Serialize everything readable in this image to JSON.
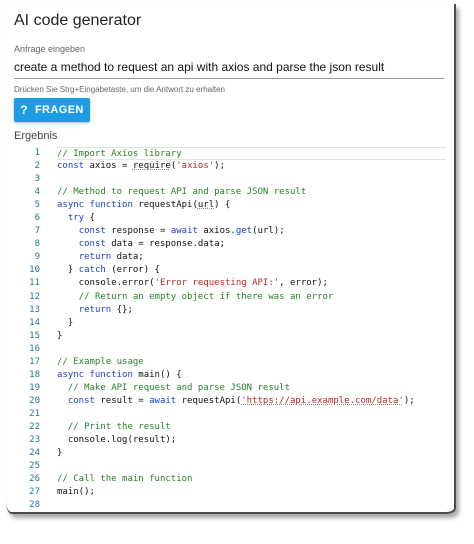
{
  "app": {
    "title": "AI code generator"
  },
  "input": {
    "label": "Anfrage eingeben",
    "value": "create a method to request an api with axios and parse the json result",
    "hint": "Drücken Sie Strg+Eingabetaste, um die Antwort zu erhalten"
  },
  "ask_button": {
    "icon": "question-mark-icon",
    "icon_glyph": "?",
    "label": "FRAGEN"
  },
  "result": {
    "label": "Ergebnis",
    "code_lines": [
      {
        "n": "1",
        "tokens": [
          {
            "t": "// Import Axios library",
            "c": "cm"
          }
        ]
      },
      {
        "n": "2",
        "tokens": [
          {
            "t": "const",
            "c": "kw"
          },
          {
            "t": " axios = ",
            "c": ""
          },
          {
            "t": "require",
            "c": "ul"
          },
          {
            "t": "(",
            "c": ""
          },
          {
            "t": "'axios'",
            "c": "st"
          },
          {
            "t": ");",
            "c": ""
          }
        ]
      },
      {
        "n": "3",
        "tokens": []
      },
      {
        "n": "4",
        "tokens": [
          {
            "t": "// Method to request API and parse JSON result",
            "c": "cm"
          }
        ]
      },
      {
        "n": "5",
        "tokens": [
          {
            "t": "async function",
            "c": "kw"
          },
          {
            "t": " requestApi(",
            "c": ""
          },
          {
            "t": "url",
            "c": "ul"
          },
          {
            "t": ") {",
            "c": ""
          }
        ]
      },
      {
        "n": "6",
        "tokens": [
          {
            "t": "  ",
            "c": ""
          },
          {
            "t": "try",
            "c": "kw"
          },
          {
            "t": " {",
            "c": ""
          }
        ]
      },
      {
        "n": "7",
        "tokens": [
          {
            "t": "    ",
            "c": ""
          },
          {
            "t": "const",
            "c": "kw"
          },
          {
            "t": " response = ",
            "c": ""
          },
          {
            "t": "await",
            "c": "kw"
          },
          {
            "t": " axios.",
            "c": ""
          },
          {
            "t": "get",
            "c": "kw"
          },
          {
            "t": "(url);",
            "c": ""
          }
        ]
      },
      {
        "n": "8",
        "tokens": [
          {
            "t": "    ",
            "c": ""
          },
          {
            "t": "const",
            "c": "kw"
          },
          {
            "t": " data = response.data;",
            "c": ""
          }
        ]
      },
      {
        "n": "9",
        "tokens": [
          {
            "t": "    ",
            "c": ""
          },
          {
            "t": "return",
            "c": "kw"
          },
          {
            "t": " data;",
            "c": ""
          }
        ]
      },
      {
        "n": "10",
        "tokens": [
          {
            "t": "  } ",
            "c": ""
          },
          {
            "t": "catch",
            "c": "kw"
          },
          {
            "t": " (error) {",
            "c": ""
          }
        ]
      },
      {
        "n": "11",
        "tokens": [
          {
            "t": "    console.error(",
            "c": ""
          },
          {
            "t": "'Error requesting API:'",
            "c": "st"
          },
          {
            "t": ", error);",
            "c": ""
          }
        ]
      },
      {
        "n": "12",
        "tokens": [
          {
            "t": "    ",
            "c": ""
          },
          {
            "t": "// Return an empty object if there was an error",
            "c": "cm"
          }
        ]
      },
      {
        "n": "13",
        "tokens": [
          {
            "t": "    ",
            "c": ""
          },
          {
            "t": "return",
            "c": "kw"
          },
          {
            "t": " {};",
            "c": ""
          }
        ]
      },
      {
        "n": "14",
        "tokens": [
          {
            "t": "  }",
            "c": ""
          }
        ]
      },
      {
        "n": "15",
        "tokens": [
          {
            "t": "}",
            "c": ""
          }
        ]
      },
      {
        "n": "16",
        "tokens": []
      },
      {
        "n": "17",
        "tokens": [
          {
            "t": "// Example usage",
            "c": "cm"
          }
        ]
      },
      {
        "n": "18",
        "tokens": [
          {
            "t": "async function",
            "c": "kw"
          },
          {
            "t": " main() {",
            "c": ""
          }
        ]
      },
      {
        "n": "19",
        "tokens": [
          {
            "t": "  ",
            "c": ""
          },
          {
            "t": "// Make API request and parse JSON result",
            "c": "cm"
          }
        ]
      },
      {
        "n": "20",
        "tokens": [
          {
            "t": "  ",
            "c": ""
          },
          {
            "t": "const",
            "c": "kw"
          },
          {
            "t": " result = ",
            "c": ""
          },
          {
            "t": "await",
            "c": "kw"
          },
          {
            "t": " requestApi(",
            "c": ""
          },
          {
            "t": "'https://api.example.com/data'",
            "c": "st ul"
          },
          {
            "t": ");",
            "c": ""
          }
        ]
      },
      {
        "n": "21",
        "tokens": []
      },
      {
        "n": "22",
        "tokens": [
          {
            "t": "  ",
            "c": ""
          },
          {
            "t": "// Print the result",
            "c": "cm"
          }
        ]
      },
      {
        "n": "23",
        "tokens": [
          {
            "t": "  console.log(result);",
            "c": ""
          }
        ]
      },
      {
        "n": "24",
        "tokens": [
          {
            "t": "}",
            "c": ""
          }
        ]
      },
      {
        "n": "25",
        "tokens": []
      },
      {
        "n": "26",
        "tokens": [
          {
            "t": "// Call the main function",
            "c": "cm"
          }
        ]
      },
      {
        "n": "27",
        "tokens": [
          {
            "t": "main();",
            "c": ""
          }
        ]
      },
      {
        "n": "28",
        "tokens": []
      }
    ]
  }
}
